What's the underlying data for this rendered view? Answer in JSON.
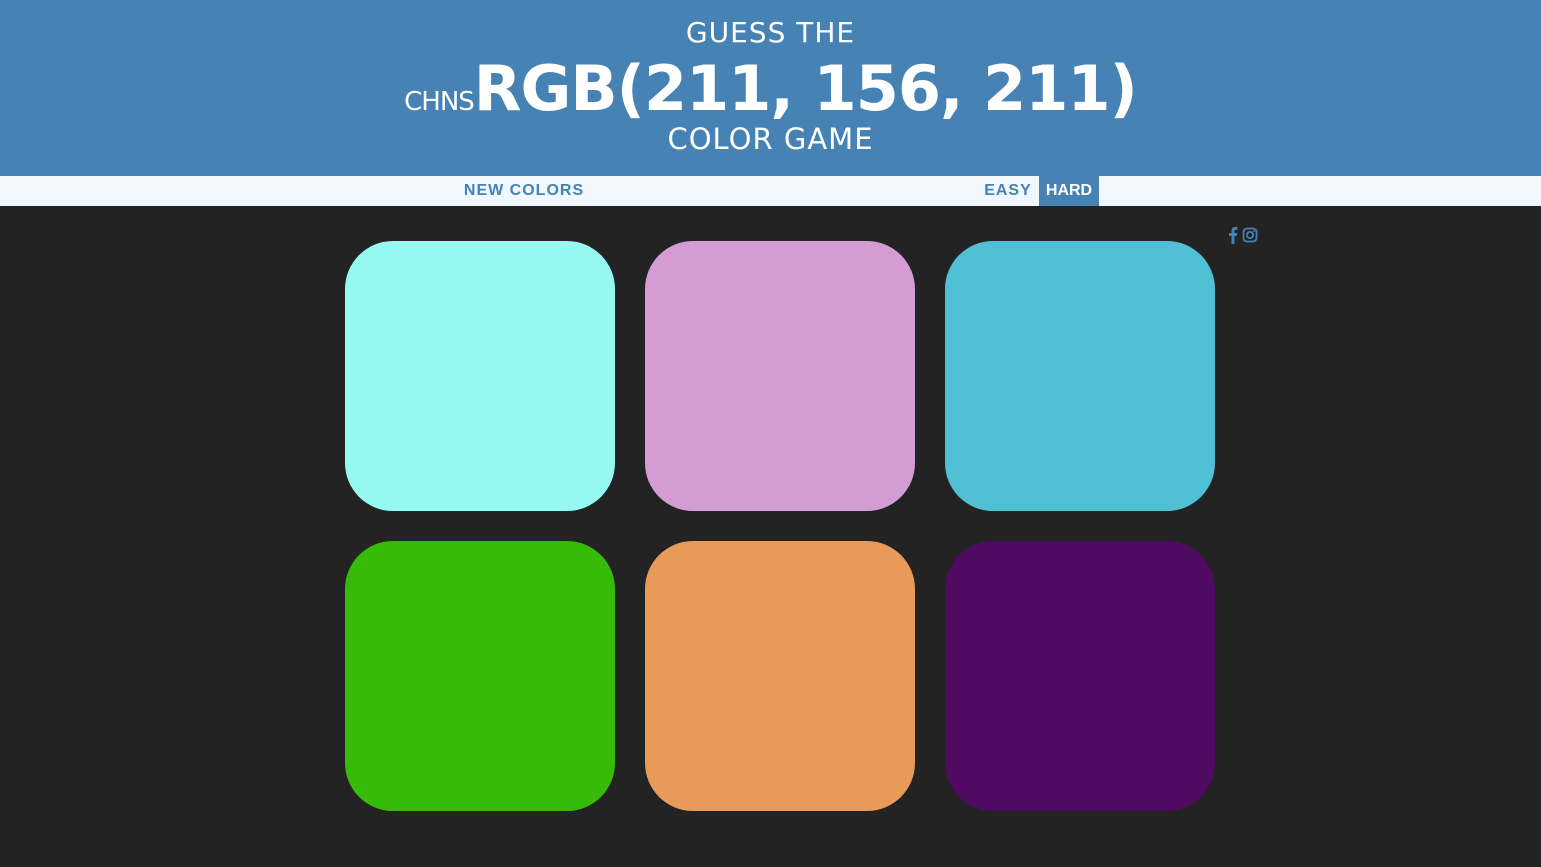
{
  "header": {
    "line1": "GUESS THE",
    "prefix": "CHNS",
    "rgb": "RGB(211, 156, 211)",
    "line3": "COLOR GAME",
    "background": "#4682b4"
  },
  "controls": {
    "new_colors": "NEW COLORS",
    "easy": "EASY",
    "hard": "HARD",
    "selected_mode": "HARD"
  },
  "social": {
    "icons": [
      "facebook-icon",
      "instagram-icon"
    ],
    "color": "#4682b4"
  },
  "board": {
    "background": "#232323",
    "squares": [
      {
        "color": "#96f9f1"
      },
      {
        "color": "#d39cd3"
      },
      {
        "color": "#51c0d5"
      },
      {
        "color": "#37bb09"
      },
      {
        "color": "#e89a59"
      },
      {
        "color": "#4f0a61"
      }
    ]
  }
}
